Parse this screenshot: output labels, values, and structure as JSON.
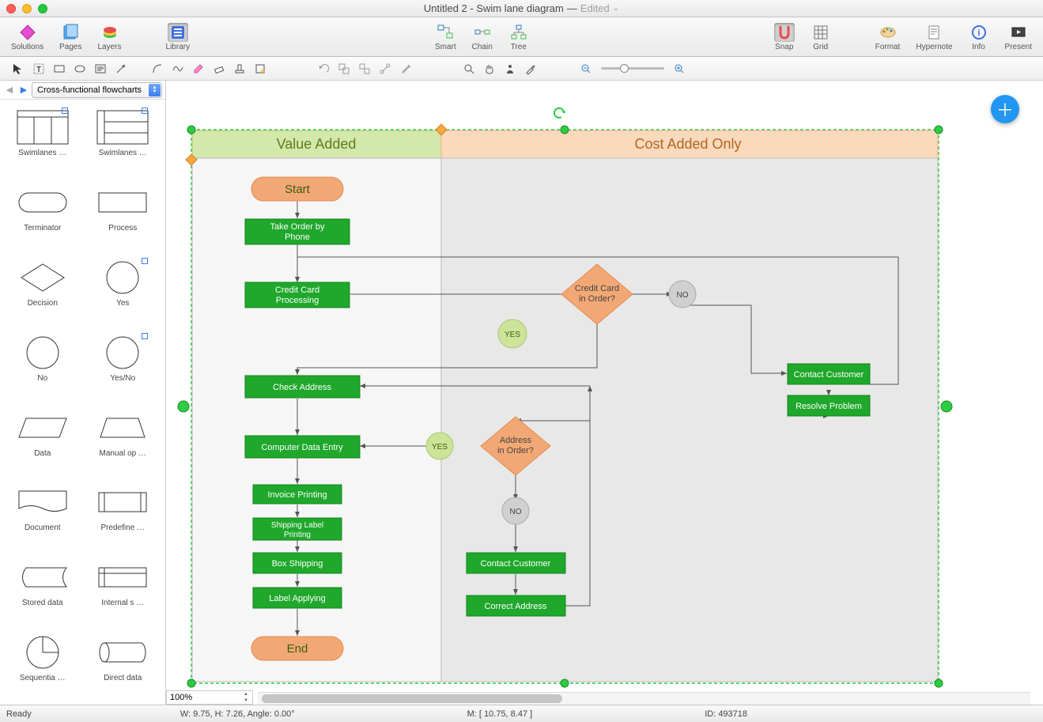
{
  "title": {
    "main": "Untitled 2 - Swim lane diagram",
    "state": "Edited"
  },
  "toolbar": {
    "solutions": "Solutions",
    "pages": "Pages",
    "layers": "Layers",
    "library": "Library",
    "smart": "Smart",
    "chain": "Chain",
    "tree": "Tree",
    "snap": "Snap",
    "grid": "Grid",
    "format": "Format",
    "hypernote": "Hypernote",
    "info": "Info",
    "present": "Present"
  },
  "library": {
    "selected": "Cross-functional flowcharts"
  },
  "shapes": [
    {
      "name": "Swimlanes …"
    },
    {
      "name": "Swimlanes …"
    },
    {
      "name": "Terminator"
    },
    {
      "name": "Process"
    },
    {
      "name": "Decision"
    },
    {
      "name": "Yes"
    },
    {
      "name": "No"
    },
    {
      "name": "Yes/No"
    },
    {
      "name": "Data"
    },
    {
      "name": "Manual op …"
    },
    {
      "name": "Document"
    },
    {
      "name": "Predefine …"
    },
    {
      "name": "Stored data"
    },
    {
      "name": "Internal s …"
    },
    {
      "name": "Sequentia …"
    },
    {
      "name": "Direct data"
    }
  ],
  "zoom": "100%",
  "status": {
    "ready": "Ready",
    "dims": "W: 9.75,  H: 7.26,  Angle: 0.00°",
    "mouse": "M: [ 10.75, 8.47 ]",
    "id": "ID: 493718"
  },
  "diagram": {
    "lanes": [
      {
        "title": "Value Added"
      },
      {
        "title": "Cost Added Only"
      }
    ],
    "nodes": {
      "start": "Start",
      "take_order": "Take Order by Phone",
      "cc_proc": "Credit Card Processing",
      "cc_ok": "Credit Card in Order?",
      "yes1": "YES",
      "no1": "NO",
      "contact1": "Contact Customer",
      "resolve": "Resolve Problem",
      "check_addr": "Check Address",
      "addr_ok": "Address in Order?",
      "yes2": "YES",
      "no2": "NO",
      "comp_entry": "Computer Data Entry",
      "invoice": "Invoice Printing",
      "ship_label": "Shipping Label Printing",
      "box": "Box Shipping",
      "label_app": "Label Applying",
      "contact2": "Contact Customer",
      "correct": "Correct Address",
      "end": "End"
    }
  }
}
